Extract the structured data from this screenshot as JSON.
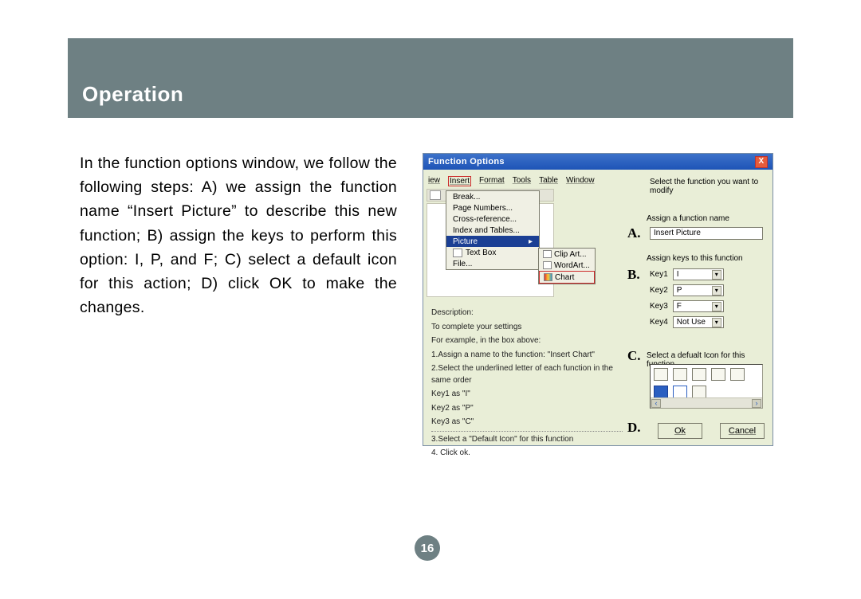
{
  "banner": {
    "title": "Operation"
  },
  "body_text": "In the function options window, we follow the following steps: A) we assign the function name “Insert Picture” to describe this new function; B) assign the keys to perform this option: I, P, and F; C) select a default icon for this action; D) click OK to make the changes.",
  "page_number": "16",
  "dialog": {
    "title": "Function Options",
    "close": "X",
    "menubar": [
      "iew",
      "Insert",
      "Format",
      "Tools",
      "Table",
      "Window"
    ],
    "menu_items": {
      "break": "Break...",
      "page_numbers": "Page Numbers...",
      "cross_ref": "Cross-reference...",
      "index_tables": "Index and Tables...",
      "picture": "Picture",
      "text_box": "Text Box",
      "file": "File..."
    },
    "submenu": {
      "clipart": "Clip Art...",
      "wordart": "WordArt...",
      "chart": "Chart"
    },
    "desc": {
      "heading": "Description:",
      "l1": "To complete your settings",
      "l2": "For example, in the box above:",
      "l3": "1.Assign a name to the function: \"Insert Chart\"",
      "l4": "2.Select the underlined letter of each function in the same order",
      "l5": "Key1 as \"I\"",
      "l6": "Key2 as \"P\"",
      "l7": "Key3 as \"C\"",
      "l8": "3.Select a \"Default Icon\" for this function",
      "l9": "4. Click ok."
    },
    "right": {
      "top_label": "Select the function you want to modify",
      "assign_label": "Assign a function name",
      "name_value": "Insert Picture",
      "keys_label": "Assign keys to this function",
      "key1_label": "Key1",
      "key1_value": "I",
      "key2_label": "Key2",
      "key2_value": "P",
      "key3_label": "Key3",
      "key3_value": "F",
      "key4_label": "Key4",
      "key4_value": "Not Use",
      "icon_label": "Select a defualt Icon for this function",
      "ok": "Ok",
      "cancel": "Cancel"
    },
    "letters": {
      "A": "A.",
      "B": "B.",
      "C": "C.",
      "D": "D."
    }
  }
}
